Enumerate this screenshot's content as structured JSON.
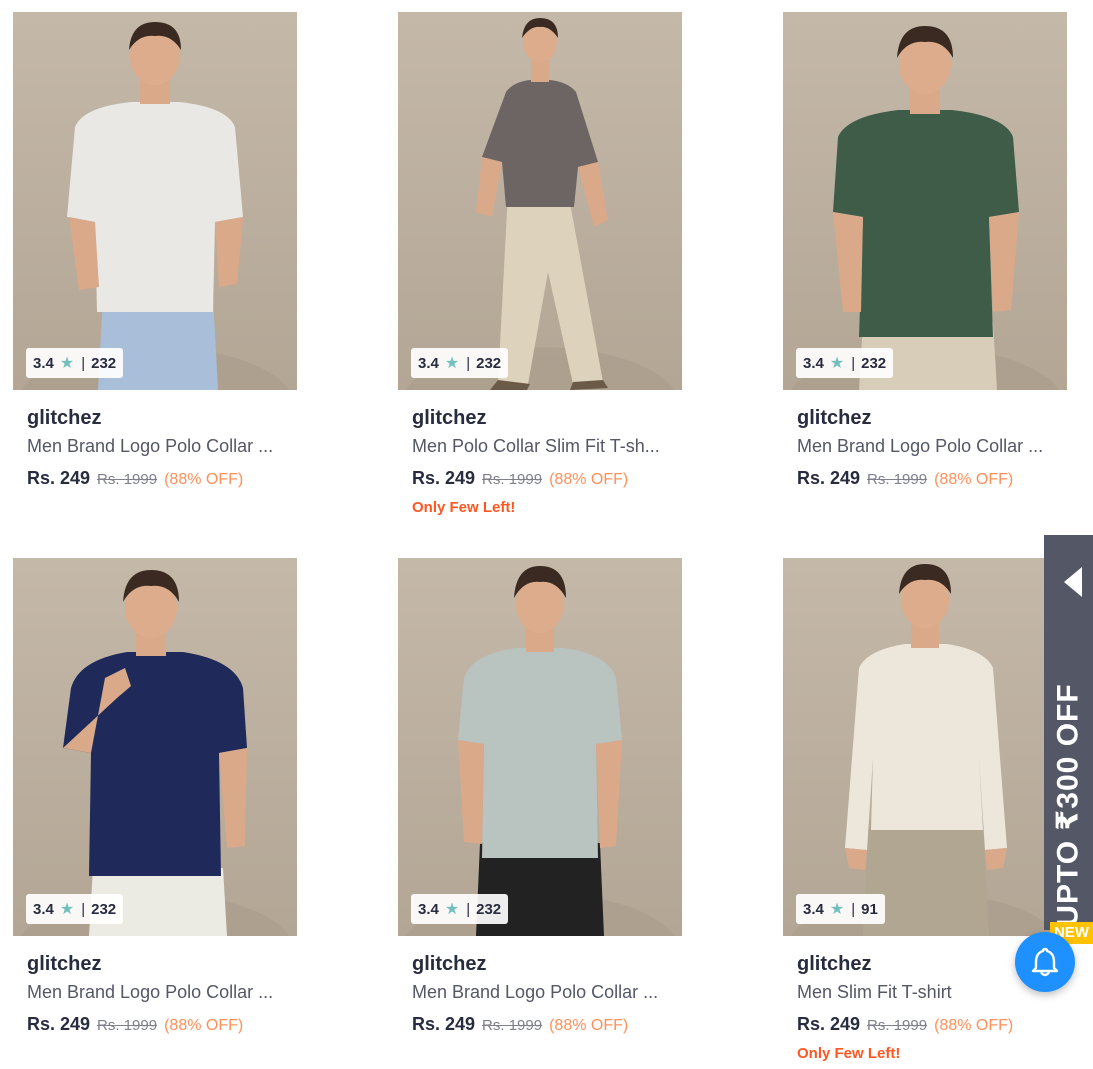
{
  "products": [
    {
      "brand": "glitchez",
      "title": "Men Brand Logo Polo Collar ...",
      "price": "Rs. 249",
      "mrp": "Rs. 1999",
      "discount": "(88% OFF)",
      "rating": "3.4",
      "rating_count": "232",
      "stock_note": "",
      "shirt_color": "#e9e8e4",
      "pants_color": "#a9bfd9"
    },
    {
      "brand": "glitchez",
      "title": "Men Polo Collar Slim Fit T-sh...",
      "price": "Rs. 249",
      "mrp": "Rs. 1999",
      "discount": "(88% OFF)",
      "rating": "3.4",
      "rating_count": "232",
      "stock_note": "Only Few Left!",
      "shirt_color": "#6d6464",
      "pants_color": "#ddd2bb"
    },
    {
      "brand": "glitchez",
      "title": "Men Brand Logo Polo Collar ...",
      "price": "Rs. 249",
      "mrp": "Rs. 1999",
      "discount": "(88% OFF)",
      "rating": "3.4",
      "rating_count": "232",
      "stock_note": "",
      "shirt_color": "#3f5c48",
      "pants_color": "#d8cdb8"
    },
    {
      "brand": "glitchez",
      "title": "Men Brand Logo Polo Collar ...",
      "price": "Rs. 249",
      "mrp": "Rs. 1999",
      "discount": "(88% OFF)",
      "rating": "3.4",
      "rating_count": "232",
      "stock_note": "",
      "shirt_color": "#1f2a5a",
      "pants_color": "#ecebe3"
    },
    {
      "brand": "glitchez",
      "title": "Men Brand Logo Polo Collar ...",
      "price": "Rs. 249",
      "mrp": "Rs. 1999",
      "discount": "(88% OFF)",
      "rating": "3.4",
      "rating_count": "232",
      "stock_note": "",
      "shirt_color": "#b9c3c0",
      "pants_color": "#222222"
    },
    {
      "brand": "glitchez",
      "title": "Men Slim Fit T-shirt",
      "price": "Rs. 249",
      "mrp": "Rs. 1999",
      "discount": "(88% OFF)",
      "rating": "3.4",
      "rating_count": "91",
      "stock_note": "Only Few Left!",
      "shirt_color": "#ece7da",
      "pants_color": "#b1a692"
    }
  ],
  "promo": {
    "text": "UPTO ₹300 OFF",
    "new_label": "NEW"
  },
  "icons": {
    "rating_star": "star-icon",
    "promo_arrow": "caret-left-icon",
    "notification": "bell-icon"
  },
  "colors": {
    "rating_star": "#72bfbc",
    "discount": "#ff905a",
    "stock_note": "#ff5722",
    "bell_bg": "#1e90ff",
    "promo_bg": "#535766",
    "new_badge": "#ffc200"
  }
}
